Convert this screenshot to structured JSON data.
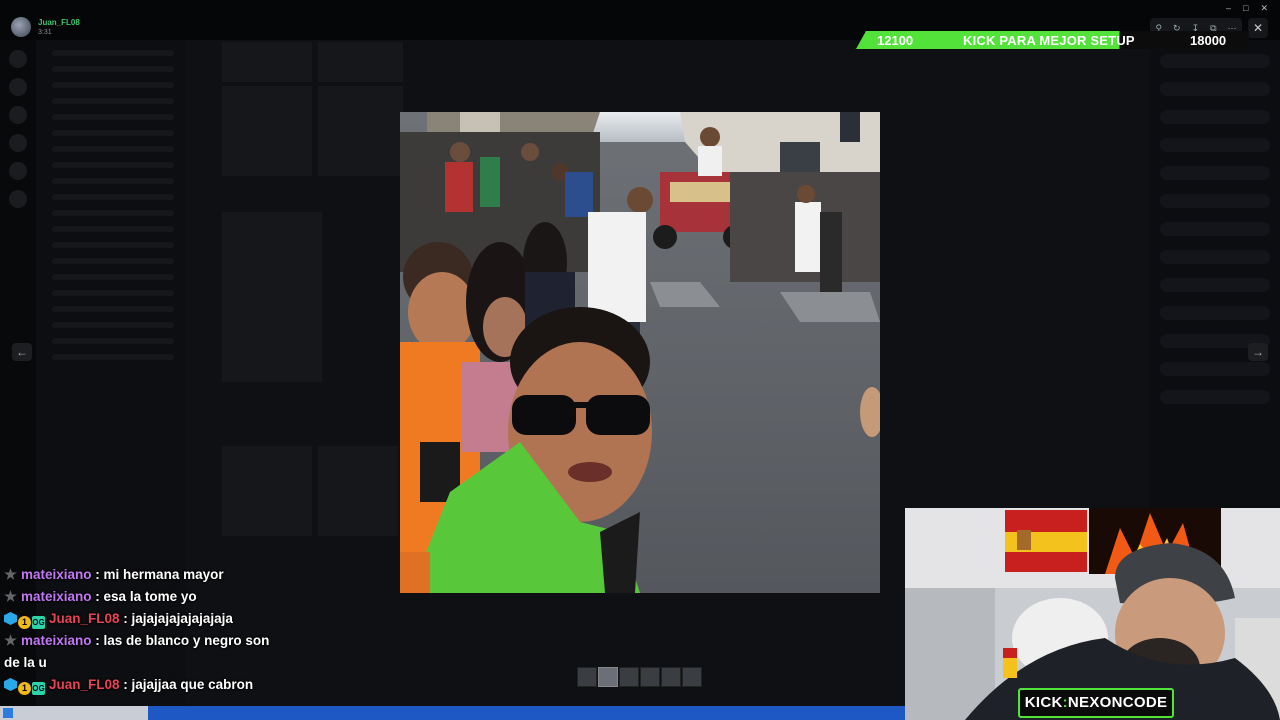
{
  "user": {
    "name": "Juan_FL08",
    "time": "3:31"
  },
  "goal": {
    "current": "12100",
    "label": "KICK PARA MEJOR SETUP",
    "target": "18000",
    "progress_fraction": 0.67,
    "color": "#53e23a"
  },
  "viewer": {
    "tools": [
      "zoom-icon",
      "rotate-icon",
      "download-icon",
      "open-icon",
      "more-icon"
    ],
    "close_icon": "close-icon",
    "prev_icon": "arrow-left-icon",
    "next_icon": "arrow-right-icon",
    "thumbnail_count": 6
  },
  "chat": [
    {
      "badges": [
        "star"
      ],
      "user": "mateixiano",
      "color": "#c178f5",
      "text": ": mi hermana mayor"
    },
    {
      "badges": [
        "star"
      ],
      "user": "mateixiano",
      "color": "#c178f5",
      "text": ": esa la tome yo"
    },
    {
      "badges": [
        "cube",
        "coin",
        "og"
      ],
      "user": "Juan_FL08",
      "color": "#e74455",
      "text": ": jajajajajajajajaja"
    },
    {
      "badges": [
        "star"
      ],
      "user": "mateixiano",
      "color": "#c178f5",
      "text": ": las de blanco y negro son de la u"
    },
    {
      "badges": [
        "cube",
        "coin",
        "og"
      ],
      "user": "Juan_FL08",
      "color": "#e74455",
      "text": ": jajajjaa que cabron"
    }
  ],
  "badges": {
    "coin": "1",
    "og": "OG"
  },
  "stream_badge": {
    "prefix": "KICK",
    "separator": ":",
    "code": "NEXONCODE"
  }
}
